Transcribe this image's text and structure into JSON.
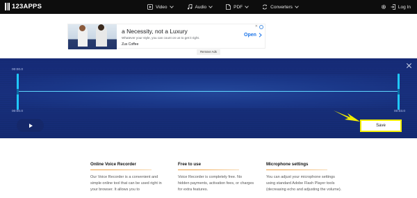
{
  "header": {
    "logo_text": "123APPS",
    "nav": [
      {
        "label": "Video",
        "icon": "play-square-icon"
      },
      {
        "label": "Audio",
        "icon": "music-note-icon"
      },
      {
        "label": "PDF",
        "icon": "pdf-file-icon"
      },
      {
        "label": "Converters",
        "icon": "convert-arrows-icon"
      }
    ],
    "login_label": "Log In"
  },
  "ad": {
    "title": "a Necessity, not a Luxury",
    "description": "Whatever your style, you can count on us to get it right.",
    "brand": "Zus Coffee",
    "open_label": "Open",
    "remove_label": "Remove Ads"
  },
  "recorder": {
    "time_top": "00:00.0",
    "time_start": "00:00.0",
    "time_end": "00:03.0",
    "save_label": "Save"
  },
  "sections": [
    {
      "title": "Online Voice Recorder",
      "body": "Our Voice Recorder is a convenient and simple online tool that can be used right in your browser. It allows you to"
    },
    {
      "title": "Free to use",
      "body": "Voice Recorder is completely free. No hidden payments, activation fees, or charges for extra features."
    },
    {
      "title": "Microphone settings",
      "body": "You can adjust your microphone settings using standard Adobe Flash Player tools (decreasing echo and adjusting the volume)."
    }
  ],
  "colors": {
    "header_bg": "#0d0d0d",
    "recorder_bg": "#18307e",
    "wave_accent": "#20c8ff",
    "highlight": "#f3ee00",
    "section_rule": "#f0a040"
  }
}
